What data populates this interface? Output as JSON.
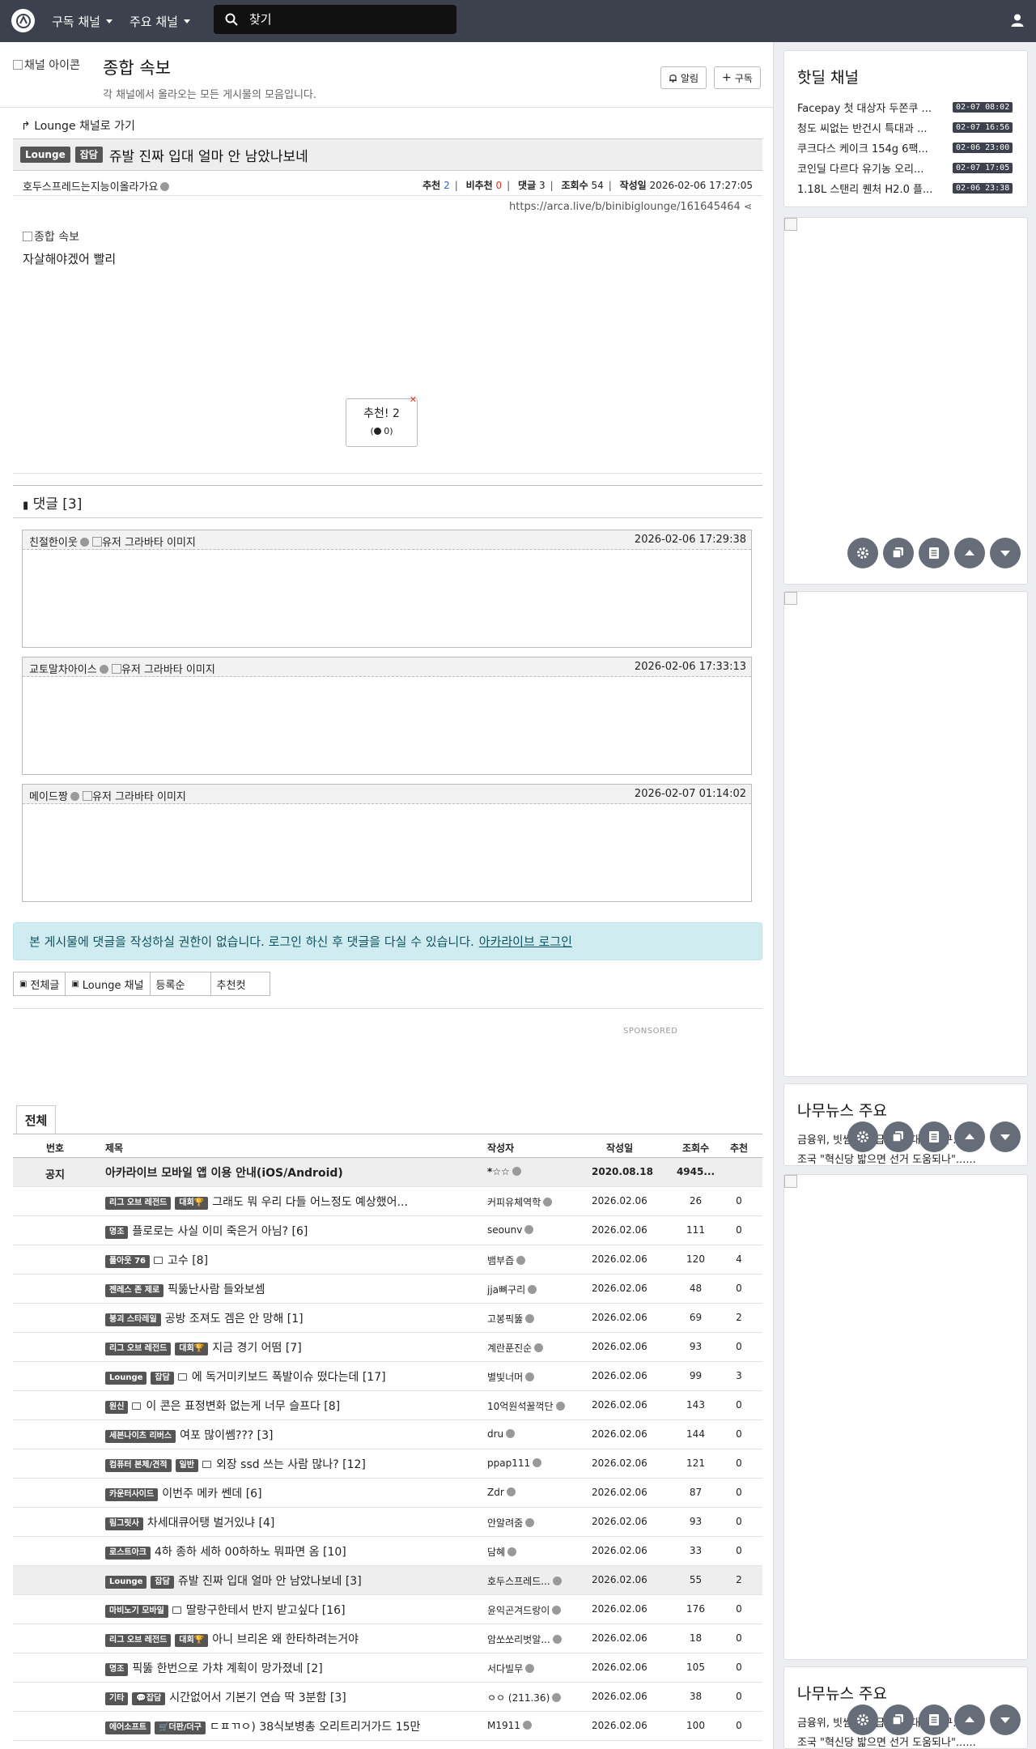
{
  "nav": {
    "logo": "로고",
    "subscribed_channels": "구독 채널",
    "major_channels": "주요 채널",
    "search_placeholder": "찾기"
  },
  "channel": {
    "image_alt": "채널 아이콘",
    "title": "종합 속보",
    "description": "각 채널에서 올라오는 모든 게시물의 모음입니다.",
    "alarm_label": "알림",
    "subscribe_label": "구독"
  },
  "post": {
    "goto_label": "Lounge 채널로 가기",
    "badge_channel": "Lounge",
    "badge_category": "잡담",
    "title": "쥬발 진짜 입대 얼마 안 남았나보네",
    "author": "호두스프레드는지능이올라가요",
    "recommend_label": "추천",
    "recommend_value": "2",
    "unrecommend_label": "비추천",
    "unrecommend_value": "0",
    "comments_label": "댓글",
    "comments_value": "3",
    "views_label": "조회수",
    "views_value": "54",
    "date_label": "작성일",
    "date_value": "2026-02-06 17:27:05",
    "url": "https://arca.live/b/binibiglounge/161645464",
    "body_image_alt": "종합 속보",
    "body_text": "자살해야겠어 빨리",
    "vote_label": "추천! 2",
    "vote_sub": "0"
  },
  "comments": {
    "header": "댓글 [3]",
    "avatar_alt": "유저 그라바타 이미지",
    "items": [
      {
        "name": "친절한이웃",
        "date": "2026-02-06 17:29:38"
      },
      {
        "name": "교토말차아이스",
        "date": "2026-02-06 17:33:13"
      },
      {
        "name": "메이드짱",
        "date": "2026-02-07 01:14:02"
      }
    ]
  },
  "alert": {
    "text": "본 게시물에 댓글을 작성하실 권한이 없습니다. 로그인 하신 후 댓글을 다실 수 있습니다.",
    "link": "아카라이브 로그인"
  },
  "filters": {
    "all": "전체글",
    "lounge": "Lounge 채널",
    "sort": "등록순",
    "best": "추천컷"
  },
  "sponsored": "SPONSORED",
  "list": {
    "tab": "전체",
    "headers": {
      "no": "번호",
      "title": "제목",
      "writer": "작성자",
      "date": "작성일",
      "views": "조회수",
      "recom": "추천"
    },
    "notice": {
      "no": "공지",
      "title": "아카라이브 모바일 앱 이용 안내(iOS/Android)",
      "writer": "*☆☆",
      "date": "2020.08.18",
      "views": "4945...",
      "recom": ""
    },
    "rows": [
      {
        "b1": "리그 오브 레전드",
        "b2": "대회🏆",
        "img": false,
        "title": "그래도 뭐 우리 다들 어느정도 예상했어...",
        "writer": "커피유체역학",
        "date": "2026.02.06",
        "views": "26",
        "recom": "0"
      },
      {
        "b1": "명조",
        "b2": "",
        "img": false,
        "title": "플로로는 사실 이미 죽은거 아님? [6]",
        "writer": "seounv",
        "date": "2026.02.06",
        "views": "111",
        "recom": "0"
      },
      {
        "b1": "폴아웃 76",
        "b2": "",
        "img": true,
        "title": "고수 [8]",
        "writer": "뱀부즙",
        "date": "2026.02.06",
        "views": "120",
        "recom": "4"
      },
      {
        "b1": "젠레스 존 제로",
        "b2": "",
        "img": false,
        "title": "픽뚫난사람 들와보셈",
        "writer": "jja뼈구리",
        "date": "2026.02.06",
        "views": "48",
        "recom": "0"
      },
      {
        "b1": "붕괴 스타레일",
        "b2": "",
        "img": false,
        "title": "공방 조져도 겜은 안 망해 [1]",
        "writer": "고봉픽뚫",
        "date": "2026.02.06",
        "views": "69",
        "recom": "2"
      },
      {
        "b1": "리그 오브 레전드",
        "b2": "대회🏆",
        "img": false,
        "title": "지금 경기 어떰 [7]",
        "writer": "계란푼진순",
        "date": "2026.02.06",
        "views": "93",
        "recom": "0"
      },
      {
        "b1": "Lounge",
        "b2": "잡담",
        "img": true,
        "title": "에 독거미키보드 폭발이슈 떴다는데 [17]",
        "writer": "별빛너머",
        "date": "2026.02.06",
        "views": "99",
        "recom": "3"
      },
      {
        "b1": "원신",
        "b2": "",
        "img": true,
        "title": "이 콘은 표정변화 없는게 너무 슬프다 [8]",
        "writer": "10억원석꿀꺽단",
        "date": "2026.02.06",
        "views": "143",
        "recom": "0"
      },
      {
        "b1": "세븐나이츠 리버스",
        "b2": "",
        "img": false,
        "title": "여포 많이쎔??? [3]",
        "writer": "dru",
        "date": "2026.02.06",
        "views": "144",
        "recom": "0"
      },
      {
        "b1": "컴퓨터 본체/견적",
        "b2": "일반",
        "img": true,
        "title": "외장 ssd 쓰는 사람 많나? [12]",
        "writer": "ppap111",
        "date": "2026.02.06",
        "views": "121",
        "recom": "0"
      },
      {
        "b1": "카운터사이드",
        "b2": "",
        "img": false,
        "title": "이번주 메카 쎈데 [6]",
        "writer": "Zdr",
        "date": "2026.02.06",
        "views": "87",
        "recom": "0"
      },
      {
        "b1": "림그릿사",
        "b2": "",
        "img": false,
        "title": "차세대큐어탱 벌거있냐 [4]",
        "writer": "안알려줌",
        "date": "2026.02.06",
        "views": "93",
        "recom": "0"
      },
      {
        "b1": "로스트아크",
        "b2": "",
        "img": false,
        "title": "4하 종하 세하 00하하노 뭐파면 옴 [10]",
        "writer": "담혜",
        "date": "2026.02.06",
        "views": "33",
        "recom": "0"
      },
      {
        "b1": "Lounge",
        "b2": "잡담",
        "img": false,
        "title": "쥬발 진짜 입대 얼마 안 남았나보네 [3]",
        "writer": "호두스프레드...",
        "date": "2026.02.06",
        "views": "55",
        "recom": "2",
        "hl": true
      },
      {
        "b1": "마비노기 모바일",
        "b2": "",
        "img": true,
        "title": "딸랑구한테서 반지 받고싶다 [16]",
        "writer": "윤익곤겨드랑이",
        "date": "2026.02.06",
        "views": "176",
        "recom": "0"
      },
      {
        "b1": "리그 오브 레전드",
        "b2": "대회🏆",
        "img": false,
        "title": "아니 브리온 왜 한타하려는거야",
        "writer": "암쏘쏘리벗알...",
        "date": "2026.02.06",
        "views": "18",
        "recom": "0"
      },
      {
        "b1": "명조",
        "b2": "",
        "img": false,
        "title": "픽뚫 한번으로 가챠 계획이 망가졌네 [2]",
        "writer": "서다빌무",
        "date": "2026.02.06",
        "views": "105",
        "recom": "0"
      },
      {
        "b1": "기타",
        "b2": "💬잡담",
        "img": false,
        "title": "시간없어서 기본기 연습 딱 3분함 [3]",
        "writer": "ㅇㅇ (211.36)",
        "date": "2026.02.06",
        "views": "38",
        "recom": "0"
      },
      {
        "b1": "에어소프트",
        "b2": "🛒더판/더구",
        "img": false,
        "title": "ㄷㅍㄲㅇ) 38식보병총 오리트리거가드 15만",
        "writer": "M1911",
        "date": "2026.02.06",
        "views": "100",
        "recom": "0"
      }
    ]
  },
  "sidebar": {
    "hotdeal_title": "핫딜 채널",
    "deals": [
      {
        "title": "Facepay 첫 대상자 두쫀쿠 ...",
        "date": "02-07 08:02"
      },
      {
        "title": "청도 씨없는 반건시 특대과 ...",
        "date": "02-07 16:56"
      },
      {
        "title": "쿠크다스 케이크 154g 6팩...",
        "date": "02-06 23:00"
      },
      {
        "title": "코인딜 다르다 유기농 오리...",
        "date": "02-07 17:05"
      },
      {
        "title": "1.18L 스탠리 퀜처 H2.0 플...",
        "date": "02-06 23:38"
      }
    ],
    "news1_title": "나무뉴스 주요",
    "news1_lines": [
      "금융위, 빗썸 오지급 사태 대응반 구...",
      "조국 \"혁신당 밟으면 선거 도움되나\"......"
    ],
    "news2_title": "나무뉴스 주요",
    "news2_lines": [
      "금융위, 빗썸 오지급 사태 대응반 구...",
      "조국 \"혁신당 밟으면 선거 도움되나\"......"
    ]
  },
  "icons": {
    "float": [
      "gear-icon",
      "copy-icon",
      "list-icon",
      "arrow-up-icon",
      "arrow-down-icon"
    ]
  }
}
